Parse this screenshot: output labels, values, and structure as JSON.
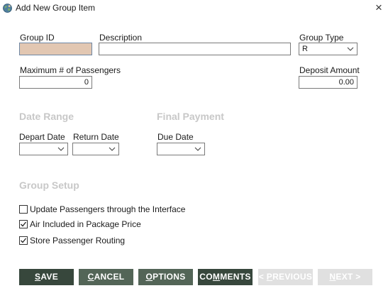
{
  "window": {
    "title": "Add New Group Item",
    "close_glyph": "×"
  },
  "form": {
    "group_id": {
      "label": "Group ID",
      "value": ""
    },
    "description": {
      "label": "Description",
      "value": ""
    },
    "group_type": {
      "label": "Group Type",
      "value": "R"
    },
    "max_passengers": {
      "label": "Maximum # of Passengers",
      "value": "0"
    },
    "deposit_amount": {
      "label": "Deposit Amount",
      "value": "0.00"
    }
  },
  "date_range": {
    "heading": "Date Range",
    "depart_label": "Depart Date",
    "depart_value": "",
    "return_label": "Return Date",
    "return_value": ""
  },
  "final_payment": {
    "heading": "Final Payment",
    "due_label": "Due Date",
    "due_value": ""
  },
  "group_setup": {
    "heading": "Group Setup",
    "options": [
      {
        "label": "Update Passengers through the Interface",
        "checked": false
      },
      {
        "label": "Air Included in Package Price",
        "checked": true
      },
      {
        "label": "Store Passenger Routing",
        "checked": true
      }
    ]
  },
  "buttons": {
    "save": {
      "pre": "",
      "mnemonic": "S",
      "post": "AVE"
    },
    "cancel": {
      "pre": "",
      "mnemonic": "C",
      "post": "ANCEL"
    },
    "options": {
      "pre": "",
      "mnemonic": "O",
      "post": "PTIONS"
    },
    "comments": {
      "pre": "CO",
      "mnemonic": "M",
      "post": "MENTS"
    },
    "previous": {
      "pre": "< ",
      "mnemonic": "P",
      "post": "REVIOUS"
    },
    "next": {
      "pre": "",
      "mnemonic": "N",
      "post": "EXT >"
    }
  },
  "colors": {
    "button_dark": "#37473c",
    "button_mid": "#536557",
    "button_disabled": "#e0e0e0",
    "section_heading": "#c8c8c8",
    "group_id_fill": "#e2c7b2"
  },
  "icons": {
    "app": "globe-user-icon",
    "close": "close-icon",
    "dropdown": "chevron-down-icon",
    "check": "checkmark-icon"
  }
}
